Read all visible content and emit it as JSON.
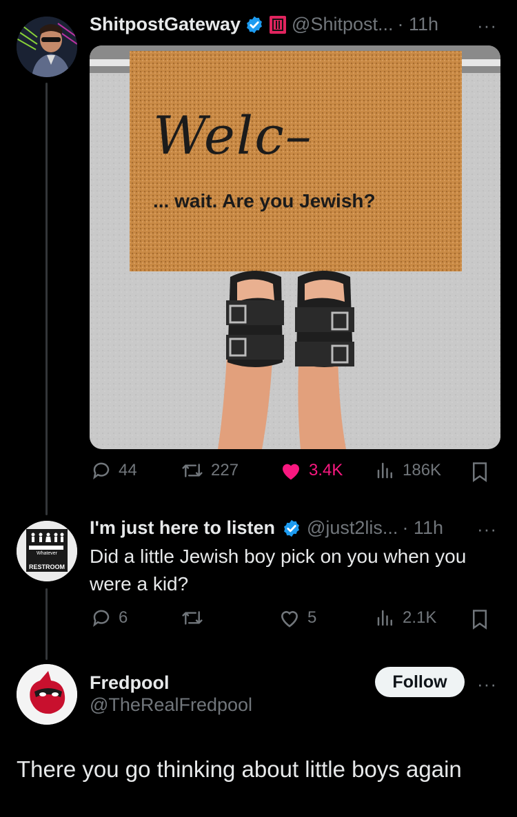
{
  "tweet1": {
    "display_name": "ShitpostGateway",
    "handle": "@Shitpost...",
    "time": "· 11h",
    "more": "···",
    "image": {
      "mat_line1": "Welc–",
      "mat_line2": "... wait. Are you Jewish?"
    },
    "stats": {
      "replies": "44",
      "retweets": "227",
      "likes": "3.4K",
      "views": "186K"
    },
    "colors": {
      "like": "#f91880",
      "verified": "#1d9bf0",
      "badge": "#e0245e"
    }
  },
  "tweet2": {
    "display_name": "I'm just here to listen",
    "handle": "@just2lis...",
    "time": "· 11h",
    "more": "···",
    "text": "Did a little Jewish boy pick on you when you were a kid?",
    "avatar": {
      "sign_small": "Whatever",
      "sign_label": "RESTROOM"
    },
    "stats": {
      "replies": "6",
      "retweets": "",
      "likes": "5",
      "views": "2.1K"
    }
  },
  "profile": {
    "display_name": "Fredpool",
    "handle": "@TheRealFredpool",
    "follow_label": "Follow",
    "more": "···",
    "reply_text": "There you go thinking about little boys again"
  }
}
